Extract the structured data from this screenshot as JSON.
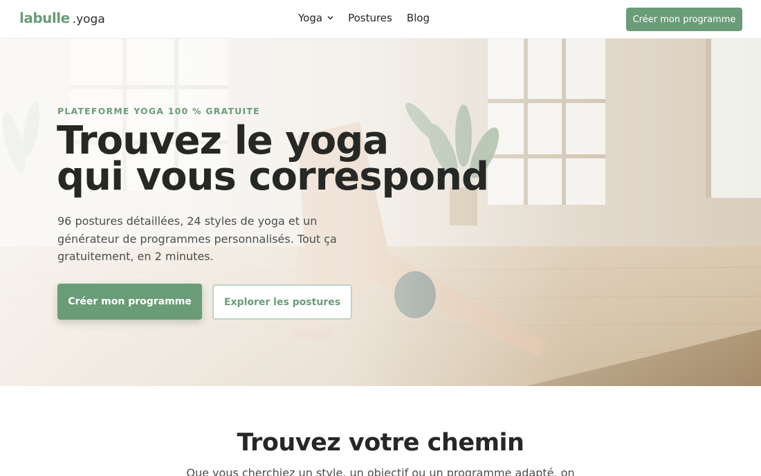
{
  "header": {
    "logo_main": "labulle",
    "logo_ext": ".yoga",
    "nav": [
      {
        "label": "Yoga"
      },
      {
        "label": "Postures"
      },
      {
        "label": "Blog"
      }
    ],
    "cta_label": "Créer mon programme"
  },
  "hero": {
    "eyebrow": "PLATEFORME YOGA 100 % GRATUITE",
    "title_line1": "Trouvez le yoga",
    "title_line2": "qui vous correspond",
    "lead": "96 postures détaillées, 24 styles de yoga et un générateur de programmes personnalisés. Tout ça gratuitement, en 2 minutes.",
    "primary_label": "Créer mon programme",
    "secondary_label": "Explorer les postures"
  },
  "section": {
    "title": "Trouvez votre chemin",
    "subtitle": "Que vous cherchiez un style, un objectif ou un programme adapté, on"
  },
  "colors": {
    "accent": "#6a9c78",
    "heading": "#262826",
    "body_text": "#4a4e4b"
  },
  "icons": {
    "nav_dropdown": "chevron-down-icon"
  }
}
